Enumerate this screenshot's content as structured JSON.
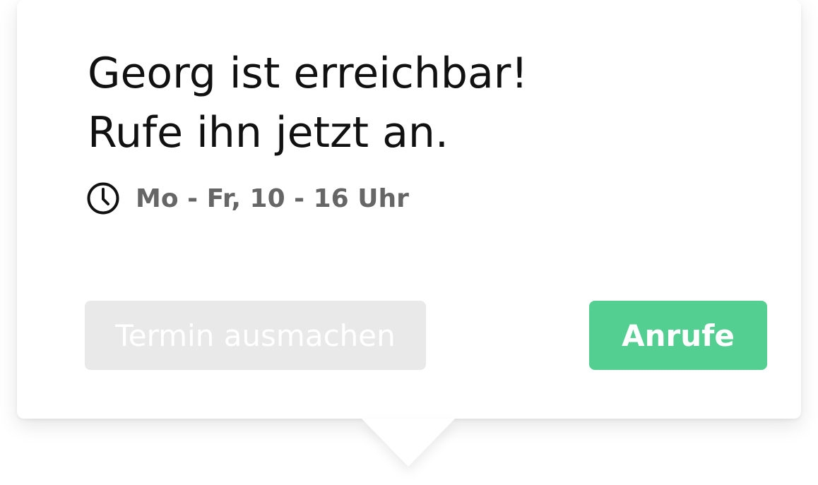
{
  "popover": {
    "headline_line1": "Georg ist erreichbar!",
    "headline_line2": "Rufe ihn jetzt an.",
    "hours": {
      "icon": "clock-icon",
      "text": "Mo - Fr, 10 - 16 Uhr"
    },
    "buttons": {
      "appointment_label": "Termin ausmachen",
      "call_label": "Anrufe"
    }
  },
  "colors": {
    "primary_button": "#54cf92",
    "secondary_button": "#e9e9e9",
    "headline_text": "#111111",
    "hours_text": "#666666"
  }
}
